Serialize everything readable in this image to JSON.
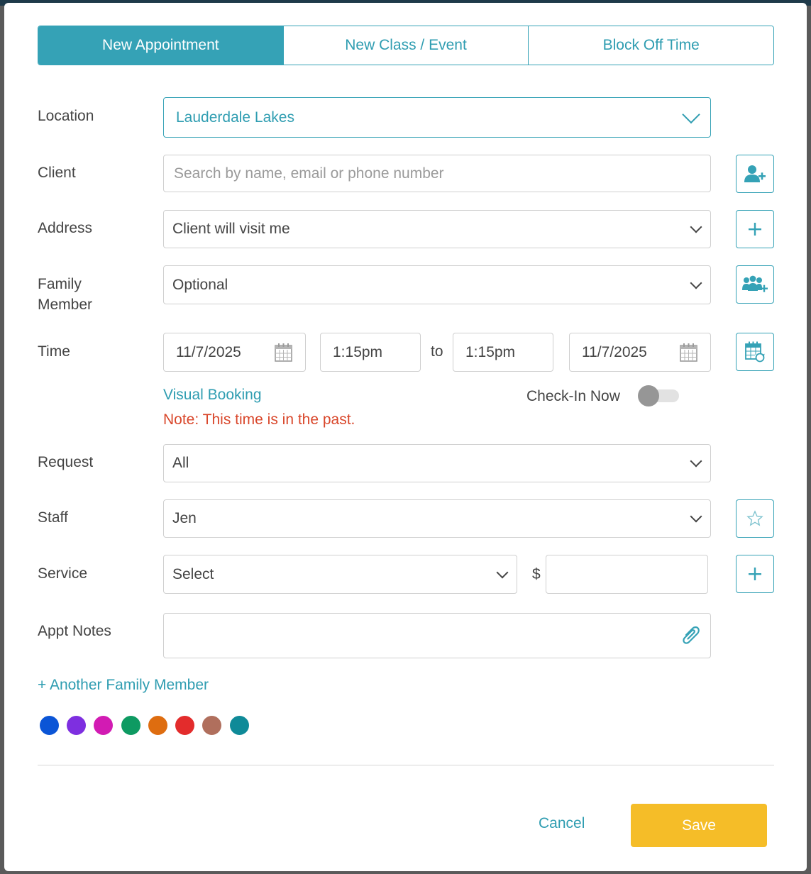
{
  "tabs": [
    {
      "label": "New Appointment",
      "active": true
    },
    {
      "label": "New Class / Event",
      "active": false
    },
    {
      "label": "Block Off Time",
      "active": false
    }
  ],
  "labels": {
    "location": "Location",
    "client": "Client",
    "address": "Address",
    "family_member_line1": "Family",
    "family_member_line2": "Member",
    "time": "Time",
    "request": "Request",
    "staff": "Staff",
    "service": "Service",
    "appt_notes": "Appt Notes"
  },
  "fields": {
    "location": "Lauderdale Lakes",
    "client_placeholder": "Search by name, email or phone number",
    "address": "Client will visit me",
    "family_member": "Optional",
    "start_date": "11/7/2025",
    "start_time": "1:15pm",
    "to_label": "to",
    "end_time": "1:15pm",
    "end_date": "11/7/2025",
    "request": "All",
    "staff": "Jen",
    "service": "Select",
    "currency": "$",
    "price": "",
    "appt_notes": ""
  },
  "visual_booking": "Visual Booking",
  "check_in_label": "Check-In Now",
  "check_in_on": false,
  "past_note": "Note: This time is in the past.",
  "another_family_member": "+ Another Family Member",
  "colors": {
    "accent": "#35a2b6",
    "warning": "#d9472b",
    "save": "#f5bd28",
    "swatches": [
      "#0b55d6",
      "#7e2fe0",
      "#d21bb3",
      "#0e9a62",
      "#de6d10",
      "#e32c2c",
      "#b06f5d",
      "#0f8a98"
    ]
  },
  "icons": {
    "add_client": "user-plus-icon",
    "add_address": "plus-icon",
    "add_family": "family-plus-icon",
    "recurring": "calendar-repeat-icon",
    "favorite": "star-icon",
    "add_service": "plus-icon",
    "attach": "paperclip-icon",
    "date": "calendar-icon"
  },
  "footer": {
    "cancel": "Cancel",
    "save": "Save"
  }
}
